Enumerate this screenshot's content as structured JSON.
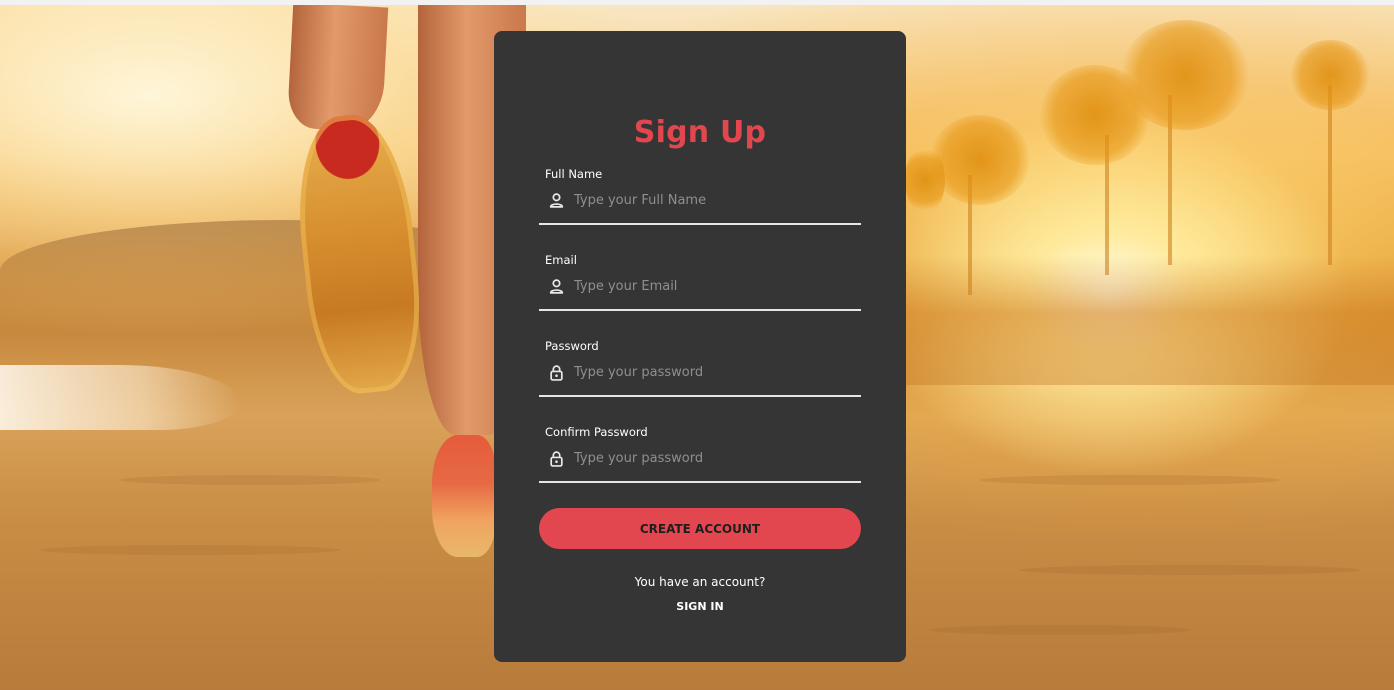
{
  "form": {
    "title": "Sign Up",
    "fields": [
      {
        "label": "Full Name",
        "placeholder": "Type your Full Name",
        "icon": "user-icon",
        "value": ""
      },
      {
        "label": "Email",
        "placeholder": "Type your Email",
        "icon": "user-icon",
        "value": ""
      },
      {
        "label": "Password",
        "placeholder": "Type your password",
        "icon": "lock-icon",
        "value": ""
      },
      {
        "label": "Confirm Password",
        "placeholder": "Type your password",
        "icon": "lock-icon",
        "value": ""
      }
    ],
    "submit_label": "CREATE ACCOUNT",
    "have_account_text": "You have an account?",
    "signin_label": "SIGN IN"
  },
  "colors": {
    "accent": "#e2474f",
    "card_background": "#353535",
    "placeholder": "#8f8f8f",
    "text": "#ffffff"
  }
}
